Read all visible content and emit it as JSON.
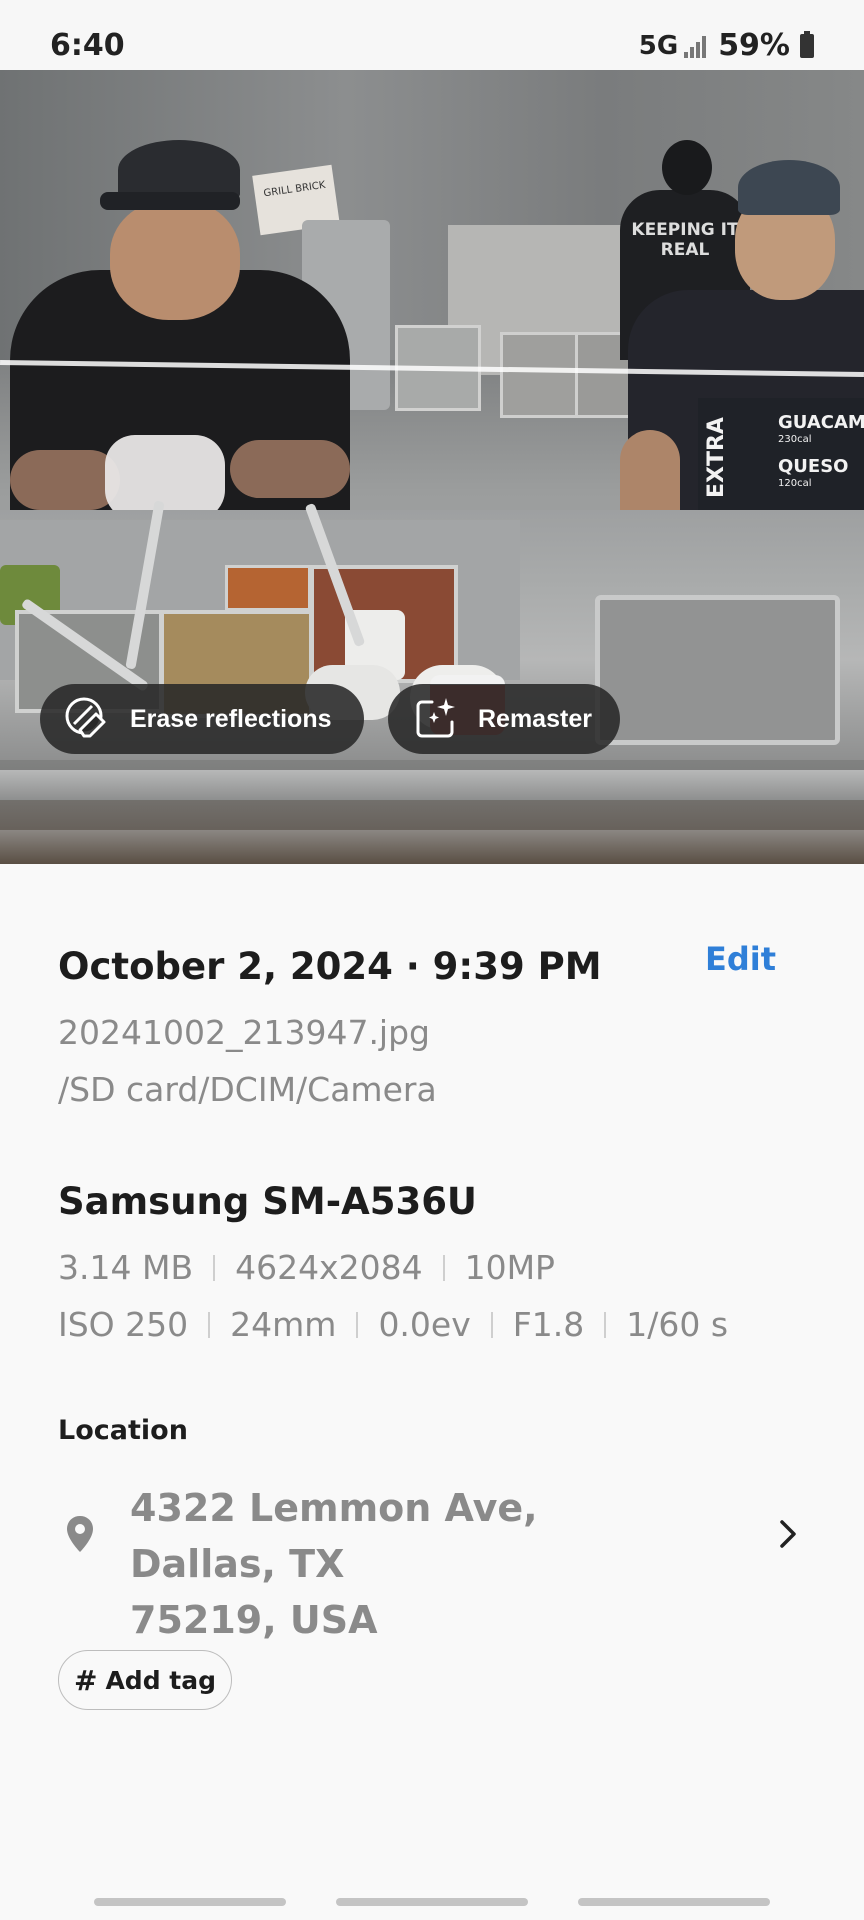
{
  "status_bar": {
    "time": "6:40",
    "network": "5G",
    "battery": "59%"
  },
  "photo": {
    "counter_menu": [
      {
        "name": "GUACAM",
        "calories": "230cal"
      },
      {
        "name": "QUESO",
        "calories": "120cal"
      }
    ],
    "extra_label": "EXTRA",
    "shirt_text": "KEEPING IT REAL",
    "box_label": "GRILL BRICK"
  },
  "actions": {
    "erase_reflections_label": "Erase reflections",
    "remaster_label": "Remaster"
  },
  "details": {
    "datetime": "October 2, 2024 · 9:39 PM",
    "edit_label": "Edit",
    "filename": "20241002_213947.jpg",
    "path": "/SD card/DCIM/Camera",
    "device": "Samsung SM-A536U",
    "file_info": [
      "3.14 MB",
      "4624x2084",
      "10MP"
    ],
    "exposure": [
      "ISO 250",
      "24mm",
      "0.0ev",
      "F1.8",
      "1/60 s"
    ]
  },
  "location": {
    "section_label": "Location",
    "address_line1": "4322 Lemmon Ave, Dallas, TX",
    "address_line2": "75219, USA"
  },
  "tags": {
    "add_tag_label": "Add tag"
  },
  "colors": {
    "accent": "#2f7fd8",
    "text_primary": "#1d1d1d",
    "text_secondary": "#8a8a8a",
    "background": "#f9f9f9"
  }
}
